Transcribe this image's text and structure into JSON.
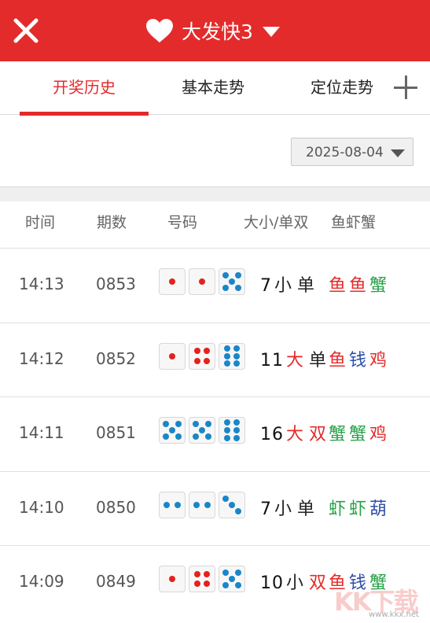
{
  "header": {
    "title": "大发快3",
    "close_icon": "close-icon",
    "heart_icon": "heart-icon",
    "dropdown_icon": "chevron-down-icon"
  },
  "tabs": [
    {
      "label": "开奖历史",
      "active": true
    },
    {
      "label": "基本走势",
      "active": false
    },
    {
      "label": "定位走势",
      "active": false
    }
  ],
  "add_icon": "plus-icon",
  "date_filter": {
    "value": "2025-08-04"
  },
  "columns": [
    "时间",
    "期数",
    "号码",
    "大小/单双",
    "鱼虾蟹"
  ],
  "colors": {
    "brand": "#e42b2b",
    "pip_red": "#e4211d",
    "pip_blue": "#1a86c8",
    "text_big": "#e42b2b",
    "text_small": "#222222",
    "fish": "#e42b2b",
    "crab": "#26a147",
    "shrimp": "#26a147",
    "money": "#2d4fa8",
    "chicken": "#e42b2b",
    "gourd": "#2d4fa8"
  },
  "rows": [
    {
      "time": "14:13",
      "issue": "0853",
      "dice": [
        1,
        1,
        5
      ],
      "sum": "7",
      "size": "小",
      "parity": "单",
      "symbols": [
        "鱼",
        "鱼",
        "蟹"
      ]
    },
    {
      "time": "14:12",
      "issue": "0852",
      "dice": [
        1,
        4,
        6
      ],
      "sum": "11",
      "size": "大",
      "parity": "单",
      "symbols": [
        "鱼",
        "钱",
        "鸡"
      ]
    },
    {
      "time": "14:11",
      "issue": "0851",
      "dice": [
        5,
        5,
        6
      ],
      "sum": "16",
      "size": "大",
      "parity": "双",
      "symbols": [
        "蟹",
        "蟹",
        "鸡"
      ]
    },
    {
      "time": "14:10",
      "issue": "0850",
      "dice": [
        2,
        2,
        3
      ],
      "sum": "7",
      "size": "小",
      "parity": "单",
      "symbols": [
        "虾",
        "虾",
        "葫"
      ]
    },
    {
      "time": "14:09",
      "issue": "0849",
      "dice": [
        1,
        4,
        5
      ],
      "sum": "10",
      "size": "小",
      "parity": "双",
      "symbols": [
        "鱼",
        "钱",
        "蟹"
      ]
    }
  ],
  "watermark": {
    "text": "KK下载",
    "url": "www.kkx.net"
  }
}
